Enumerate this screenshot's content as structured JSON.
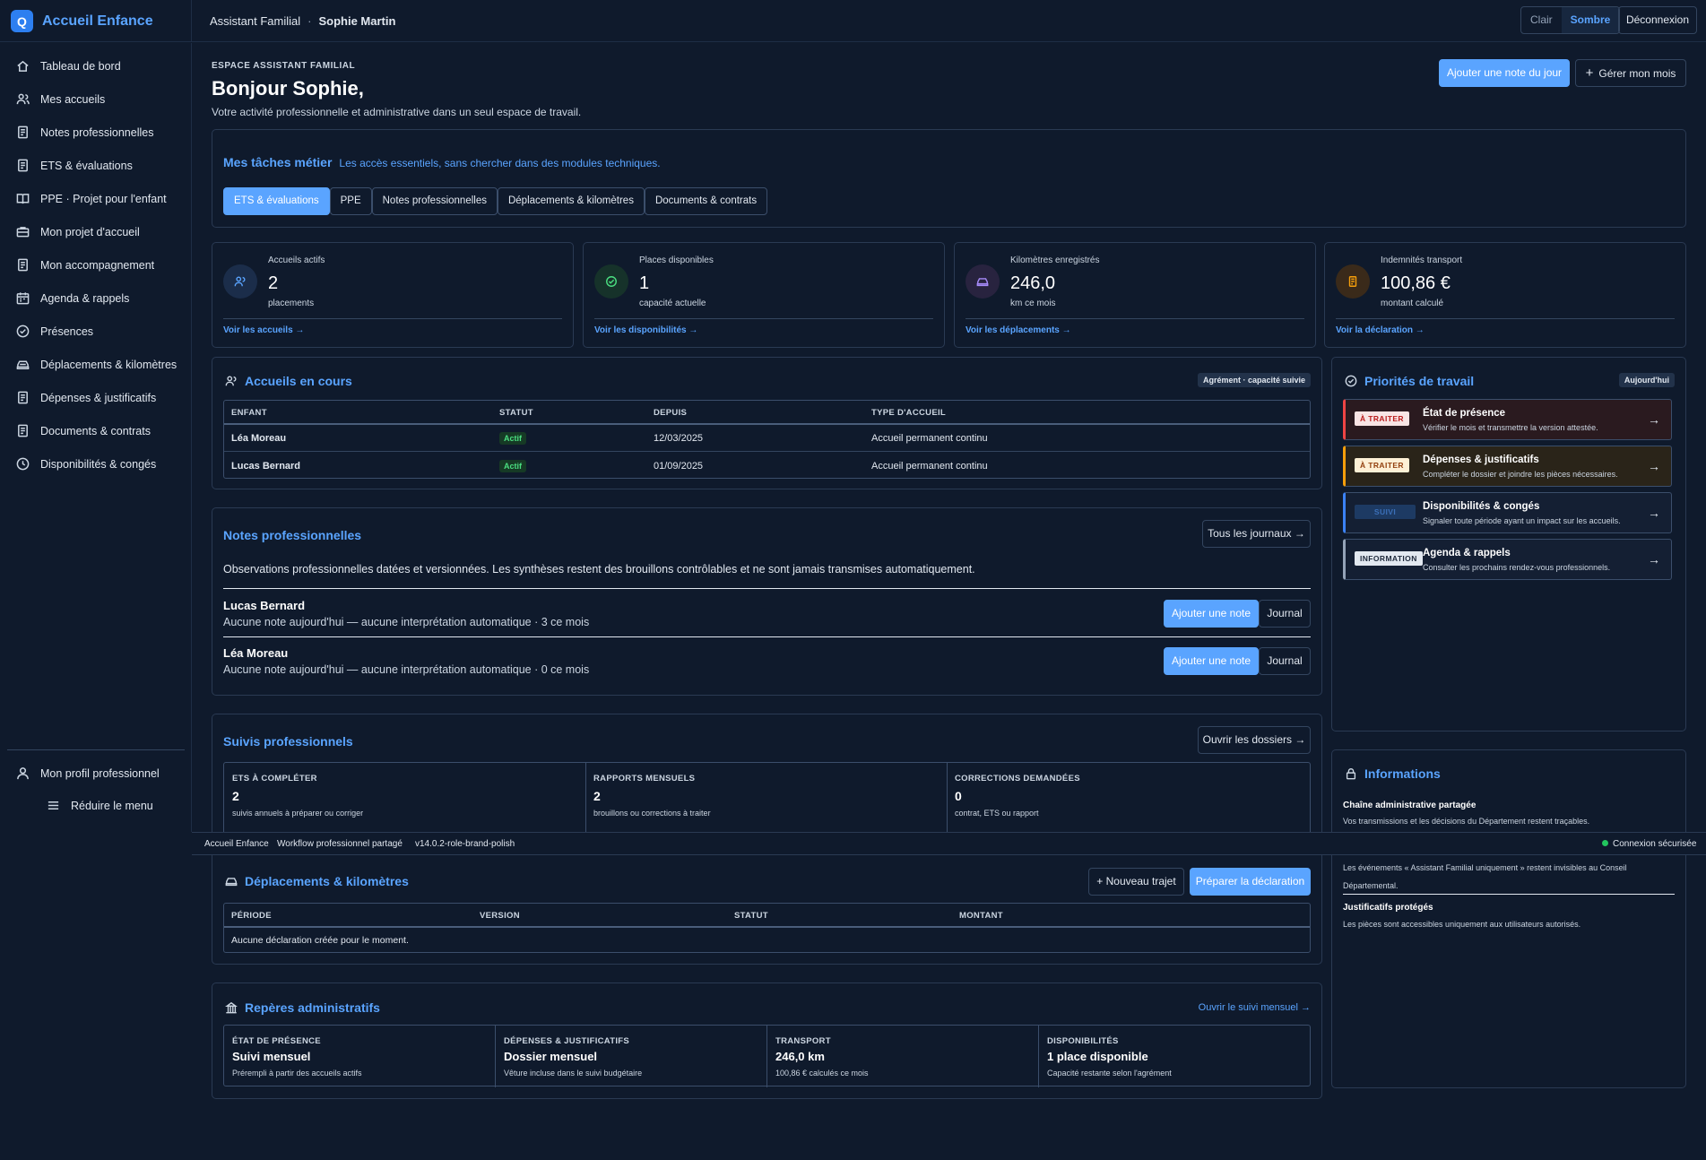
{
  "app": {
    "name": "Accueil Enfance",
    "logo_letter": "Q"
  },
  "header": {
    "role": "Assistant Familial",
    "sep": "·",
    "user": "Sophie Martin",
    "theme_light": "Clair",
    "theme_dark": "Sombre",
    "logout": "Déconnexion"
  },
  "sidebar": {
    "items": [
      "Tableau de bord",
      "Mes accueils",
      "Notes professionnelles",
      "ETS & évaluations",
      "PPE · Projet pour l'enfant",
      "Mon projet d'accueil",
      "Mon accompagnement",
      "Agenda & rappels",
      "Présences",
      "Déplacements & kilomètres",
      "Dépenses & justificatifs",
      "Documents & contrats",
      "Disponibilités & congés"
    ],
    "profile": "Mon profil professionnel",
    "collapse": "Réduire le menu"
  },
  "page": {
    "eyebrow": "ESPACE ASSISTANT FAMILIAL",
    "title": "Bonjour Sophie,",
    "subtitle": "Votre activité professionnelle et administrative dans un seul espace de travail.",
    "add_note_day": "Ajouter une note du jour",
    "manage_month": "Gérer mon mois"
  },
  "tasks": {
    "title": "Mes tâches métier",
    "subtitle": "Les accès essentiels, sans chercher dans des modules techniques.",
    "tabs": [
      "ETS & évaluations",
      "PPE",
      "Notes professionnelles",
      "Déplacements & kilomètres",
      "Documents & contrats"
    ]
  },
  "kpis": [
    {
      "label": "Accueils actifs",
      "value": "2",
      "unit": "placements",
      "link": "Voir les accueils →"
    },
    {
      "label": "Places disponibles",
      "value": "1",
      "unit": "capacité actuelle",
      "link": "Voir les disponibilités →"
    },
    {
      "label": "Kilomètres enregistrés",
      "value": "246,0",
      "unit": "km ce mois",
      "link": "Voir les déplacements →"
    },
    {
      "label": "Indemnités transport",
      "value": "100,86 €",
      "unit": "montant calculé",
      "link": "Voir la déclaration →"
    }
  ],
  "placements": {
    "title": "Accueils en cours",
    "chip": "Agrément · capacité suivie",
    "columns": [
      "ENFANT",
      "STATUT",
      "DEPUIS",
      "TYPE D'ACCUEIL"
    ],
    "rows": [
      {
        "child": "Léa Moreau",
        "status": "Actif",
        "since": "12/03/2025",
        "type": "Accueil permanent continu"
      },
      {
        "child": "Lucas Bernard",
        "status": "Actif",
        "since": "01/09/2025",
        "type": "Accueil permanent continu"
      }
    ]
  },
  "priorities": {
    "title": "Priorités de travail",
    "chip": "Aujourd'hui",
    "items": [
      {
        "tag": "À TRAITER",
        "title": "État de présence",
        "desc": "Vérifier le mois et transmettre la version attestée.",
        "color": "#ef4444"
      },
      {
        "tag": "À TRAITER",
        "title": "Dépenses & justificatifs",
        "desc": "Compléter le dossier et joindre les pièces nécessaires.",
        "color": "#f59e0b"
      },
      {
        "tag": "SUIVI",
        "title": "Disponibilités & congés",
        "desc": "Signaler toute période ayant un impact sur les accueils.",
        "color": "#3b82f6"
      },
      {
        "tag": "INFORMATION",
        "title": "Agenda & rappels",
        "desc": "Consulter les prochains rendez-vous professionnels.",
        "color": "#94a3b8"
      }
    ],
    "arrow": "→"
  },
  "notes": {
    "title": "Notes professionnelles",
    "all_journals": "Tous les journaux →",
    "intro": "Observations professionnelles datées et versionnées. Les synthèses restent des brouillons contrôlables et ne sont jamais transmises automatiquement.",
    "children": [
      {
        "name": "Lucas Bernard",
        "desc": "Aucune note aujourd'hui — aucune interprétation automatique · 3 ce mois"
      },
      {
        "name": "Léa Moreau",
        "desc": "Aucune note aujourd'hui — aucune interprétation automatique · 0 ce mois"
      }
    ],
    "add": "Ajouter une note",
    "journal": "Journal"
  },
  "follow": {
    "title": "Suivis professionnels",
    "open": "Ouvrir les dossiers →",
    "cells": [
      {
        "h": "ETS À COMPLÉTER",
        "v": "2",
        "d": "suivis annuels à préparer ou corriger"
      },
      {
        "h": "RAPPORTS MENSUELS",
        "v": "2",
        "d": "brouillons ou corrections à traiter"
      },
      {
        "h": "CORRECTIONS DEMANDÉES",
        "v": "0",
        "d": "contrat, ETS ou rapport"
      }
    ]
  },
  "info": {
    "title": "Informations",
    "items": [
      {
        "h": "Chaîne administrative partagée",
        "d": "Vos transmissions et les décisions du Département restent traçables."
      },
      {
        "h": "",
        "d": "Les événements « Assistant Familial uniquement » restent invisibles au Conseil Départemental."
      },
      {
        "h": "Justificatifs protégés",
        "d": "Les pièces sont accessibles uniquement aux utilisateurs autorisés."
      }
    ]
  },
  "footer": {
    "app": "Accueil Enfance",
    "workflow": "Workflow professionnel partagé",
    "version": "v14.0.2-role-brand-polish",
    "secure": "Connexion sécurisée"
  },
  "trips": {
    "title": "Déplacements & kilomètres",
    "new_trip": "+ Nouveau trajet",
    "prepare": "Préparer la déclaration",
    "columns": [
      "PÉRIODE",
      "VERSION",
      "STATUT",
      "MONTANT"
    ],
    "empty": "Aucune déclaration créée pour le moment."
  },
  "admin": {
    "title": "Repères administratifs",
    "open": "Ouvrir le suivi mensuel →",
    "cells": [
      {
        "h": "ÉTAT DE PRÉSENCE",
        "v": "Suivi mensuel",
        "d": "Prérempli à partir des accueils actifs"
      },
      {
        "h": "DÉPENSES & JUSTIFICATIFS",
        "v": "Dossier mensuel",
        "d": "Vêture incluse dans le suivi budgétaire"
      },
      {
        "h": "TRANSPORT",
        "v": "246,0 km",
        "d": "100,86 € calculés ce mois"
      },
      {
        "h": "DISPONIBILITÉS",
        "v": "1 place disponible",
        "d": "Capacité restante selon l'agrément"
      }
    ]
  }
}
